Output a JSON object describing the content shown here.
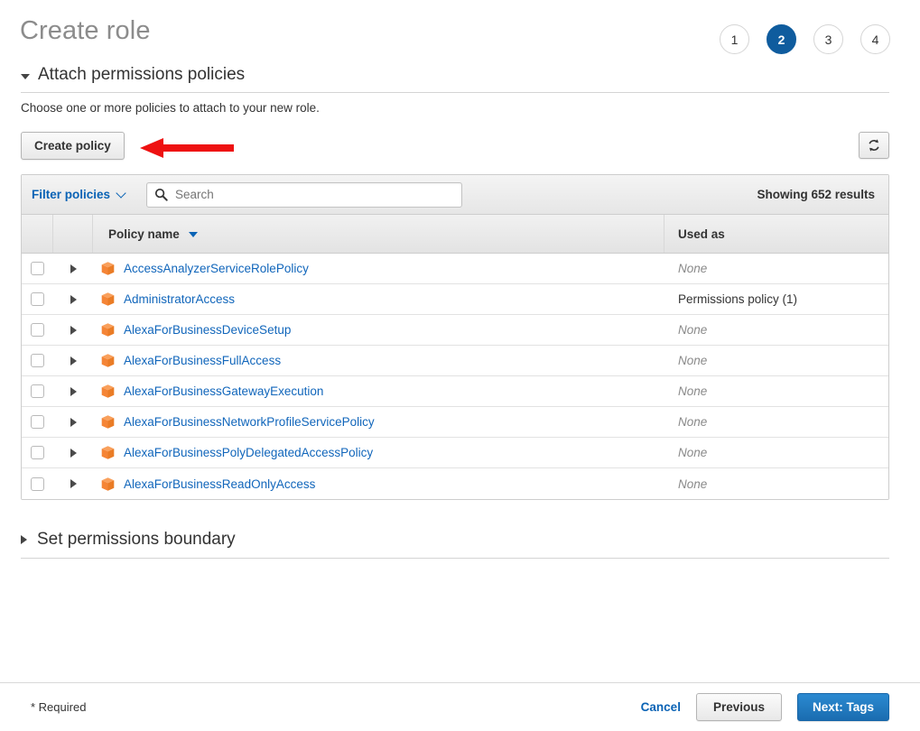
{
  "header": {
    "title": "Create role",
    "steps": [
      {
        "label": "1",
        "active": false
      },
      {
        "label": "2",
        "active": true
      },
      {
        "label": "3",
        "active": false
      },
      {
        "label": "4",
        "active": false
      }
    ]
  },
  "section": {
    "title": "Attach permissions policies",
    "subtitle": "Choose one or more policies to attach to your new role.",
    "create_policy_label": "Create policy",
    "refresh_icon": "refresh-icon"
  },
  "filter_bar": {
    "filter_label": "Filter policies",
    "chevron_icon": "chevron-down-icon",
    "search_placeholder": "Search",
    "search_value": "",
    "search_icon": "search-icon",
    "results_text": "Showing 652 results"
  },
  "table": {
    "columns": {
      "policy_name": "Policy name",
      "used_as": "Used as"
    },
    "sort_icon": "sort-descending-caret-icon",
    "rows": [
      {
        "name": "AccessAnalyzerServiceRolePolicy",
        "used_as": "None",
        "used_as_none": true
      },
      {
        "name": "AdministratorAccess",
        "used_as": "Permissions policy (1)",
        "used_as_none": false
      },
      {
        "name": "AlexaForBusinessDeviceSetup",
        "used_as": "None",
        "used_as_none": true
      },
      {
        "name": "AlexaForBusinessFullAccess",
        "used_as": "None",
        "used_as_none": true
      },
      {
        "name": "AlexaForBusinessGatewayExecution",
        "used_as": "None",
        "used_as_none": true
      },
      {
        "name": "AlexaForBusinessNetworkProfileServicePolicy",
        "used_as": "None",
        "used_as_none": true
      },
      {
        "name": "AlexaForBusinessPolyDelegatedAccessPolicy",
        "used_as": "None",
        "used_as_none": true
      },
      {
        "name": "AlexaForBusinessReadOnlyAccess",
        "used_as": "None",
        "used_as_none": true
      }
    ]
  },
  "boundary": {
    "title": "Set permissions boundary",
    "caret_icon": "caret-right-icon"
  },
  "footer": {
    "required_text": "* Required",
    "cancel_label": "Cancel",
    "previous_label": "Previous",
    "next_label": "Next: Tags"
  },
  "annotation": {
    "arrow_icon": "red-left-arrow-icon",
    "arrow_color": "#ee1111"
  },
  "colors": {
    "accent_blue": "#0f5c9e",
    "link_blue": "#1166bb",
    "policy_icon_orange": "#f58536",
    "annotation_red": "#ee1111"
  }
}
